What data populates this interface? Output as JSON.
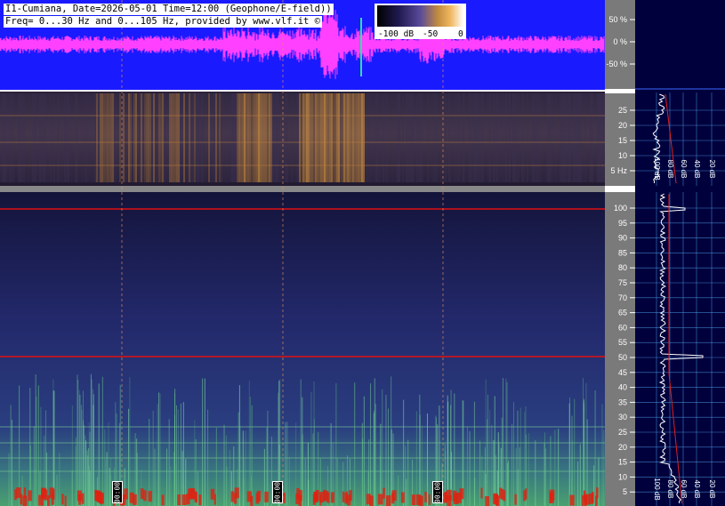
{
  "header": {
    "line1": "I1-Cumiana, Date=2026-05-01 Time=12:00 (Geophone/E-field))",
    "line2": "Freq= 0...30 Hz and 0...105 Hz, provided by www.vlf.it ©"
  },
  "colorbar": {
    "labels": [
      "-100 dB",
      "-50",
      "0"
    ]
  },
  "amplitude_axis": {
    "labels": [
      "50 %",
      "0 %",
      "-50 %"
    ]
  },
  "low_freq_axis": {
    "labels": [
      "25",
      "20",
      "15",
      "10",
      "5 Hz"
    ]
  },
  "high_freq_axis": {
    "labels": [
      "100",
      "95",
      "90",
      "85",
      "80",
      "75",
      "70",
      "65",
      "60",
      "55",
      "50",
      "45",
      "40",
      "35",
      "30",
      "25",
      "20",
      "15",
      "10",
      "5"
    ]
  },
  "spectrum_upper": {
    "db_labels": [
      "100 dB",
      "80 dB",
      "60 dB",
      "40 dB",
      "20 dB"
    ]
  },
  "spectrum_lower": {
    "db_labels": [
      "100 dB",
      "80 dB",
      "60 dB",
      "40 dB",
      "20 dB"
    ]
  },
  "time_markers": [
    "00:00",
    "00:00",
    "00:00"
  ],
  "colors": {
    "waveform_bg": "#1a1aff",
    "waveform_trace": "#ff40ff",
    "spectrum_panel": "#00003c",
    "mains_line": "#e01010",
    "grid_line": "#5ab4ff"
  }
}
